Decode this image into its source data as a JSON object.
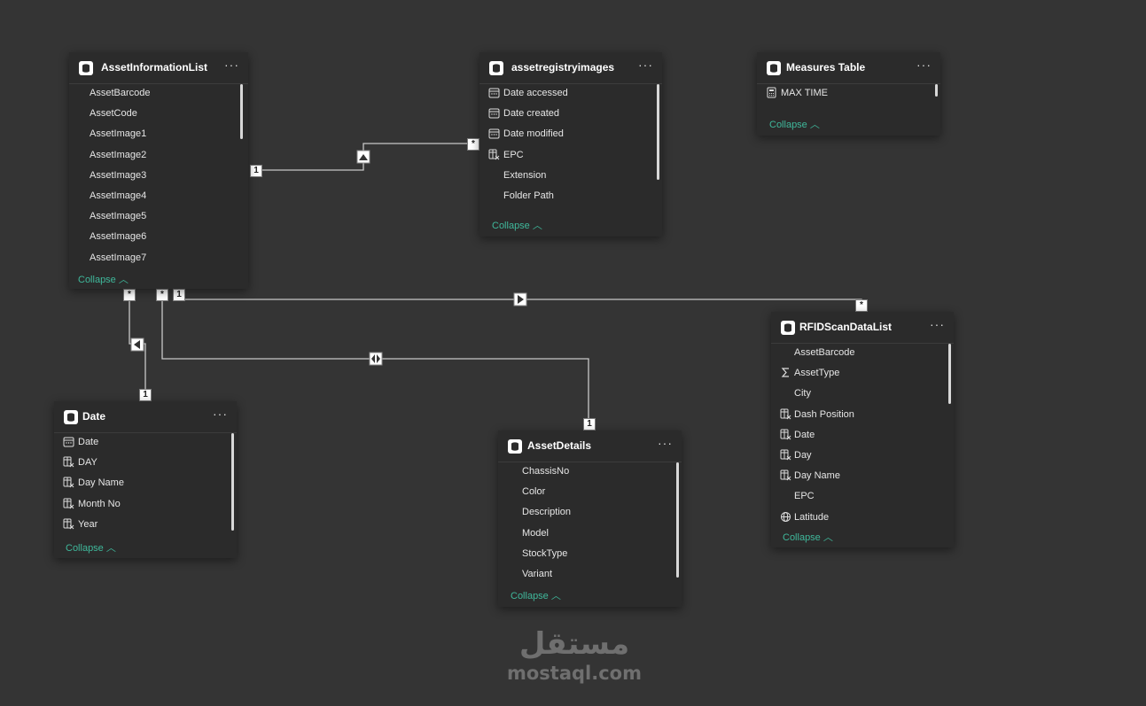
{
  "tables": {
    "asset_information_list": {
      "title": "AssetInformationList",
      "menu": "···",
      "fields": [
        "AssetBarcode",
        "AssetCode",
        "AssetImage1",
        "AssetImage2",
        "AssetImage3",
        "AssetImage4",
        "AssetImage5",
        "AssetImage6",
        "AssetImage7"
      ],
      "collapse": "Collapse"
    },
    "asset_registry_images": {
      "title": "assetregistryimages",
      "menu": "···",
      "fields": [
        "Date accessed",
        "Date created",
        "Date modified",
        "EPC",
        "Extension",
        "Folder Path"
      ],
      "collapse": "Collapse"
    },
    "measures_table": {
      "title": "Measures Table",
      "menu": "···",
      "fields": [
        "MAX TIME"
      ],
      "collapse": "Collapse"
    },
    "rfid_scan_data_list": {
      "title": "RFIDScanDataList",
      "menu": "···",
      "fields": [
        "AssetBarcode",
        "AssetType",
        "City",
        "Dash Position",
        "Date",
        "Day",
        "Day Name",
        "EPC",
        "Latitude"
      ],
      "collapse": "Collapse"
    },
    "date": {
      "title": "Date",
      "menu": "···",
      "fields": [
        "Date",
        "DAY",
        "Day Name",
        "Month No",
        "Year"
      ],
      "collapse": "Collapse"
    },
    "asset_details": {
      "title": "AssetDetails",
      "menu": "···",
      "fields": [
        "ChassisNo",
        "Color",
        "Description",
        "Model",
        "StockType",
        "Variant"
      ],
      "collapse": "Collapse"
    }
  },
  "cardinality": {
    "one": "1",
    "many": "*"
  },
  "icons": {
    "table": "table-icon",
    "calendar": "calendar-icon",
    "calculated_column": "calculated-column-icon",
    "sigma": "sigma-icon",
    "globe": "globe-icon",
    "measure": "calculator-icon",
    "chevron": "chevron-up-icon"
  },
  "colors": {
    "canvas": "#343434",
    "card": "#2b2b2b",
    "accent": "#3fb89b",
    "line": "#c8c8c8"
  },
  "watermark": {
    "arabic": "مستقل",
    "latin": "mostaql.com"
  }
}
